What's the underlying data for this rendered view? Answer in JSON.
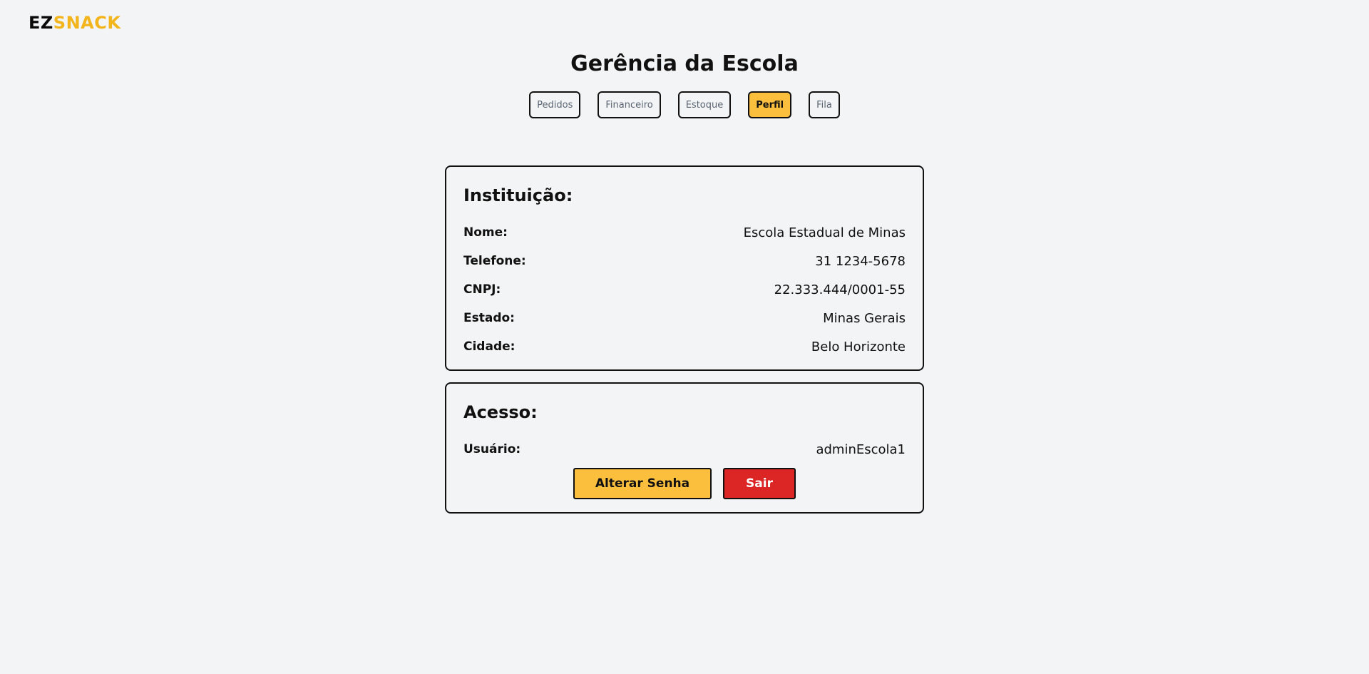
{
  "logo": {
    "part1": "EZ",
    "part2": "SNACK",
    "color_dark": "#0a0a0a",
    "color_accent": "#f2b51c"
  },
  "page": {
    "title": "Gerência da Escola"
  },
  "tabs": [
    {
      "label": "Pedidos",
      "active": false
    },
    {
      "label": "Financeiro",
      "active": false
    },
    {
      "label": "Estoque",
      "active": false
    },
    {
      "label": "Perfil",
      "active": true
    },
    {
      "label": "Fila",
      "active": false
    }
  ],
  "institution": {
    "title": "Instituição:",
    "fields": [
      {
        "label": "Nome:",
        "value": "Escola Estadual de Minas"
      },
      {
        "label": "Telefone:",
        "value": "31 1234-5678"
      },
      {
        "label": "CNPJ:",
        "value": "22.333.444/0001-55"
      },
      {
        "label": "Estado:",
        "value": "Minas Gerais"
      },
      {
        "label": "Cidade:",
        "value": "Belo Horizonte"
      }
    ]
  },
  "access": {
    "title": "Acesso:",
    "user_label": "Usuário:",
    "user_value": "adminEscola1",
    "change_password_label": "Alterar Senha",
    "logout_label": "Sair"
  },
  "colors": {
    "background": "#f2f4f6",
    "accent": "#fbbf3d",
    "danger": "#dc2626"
  }
}
